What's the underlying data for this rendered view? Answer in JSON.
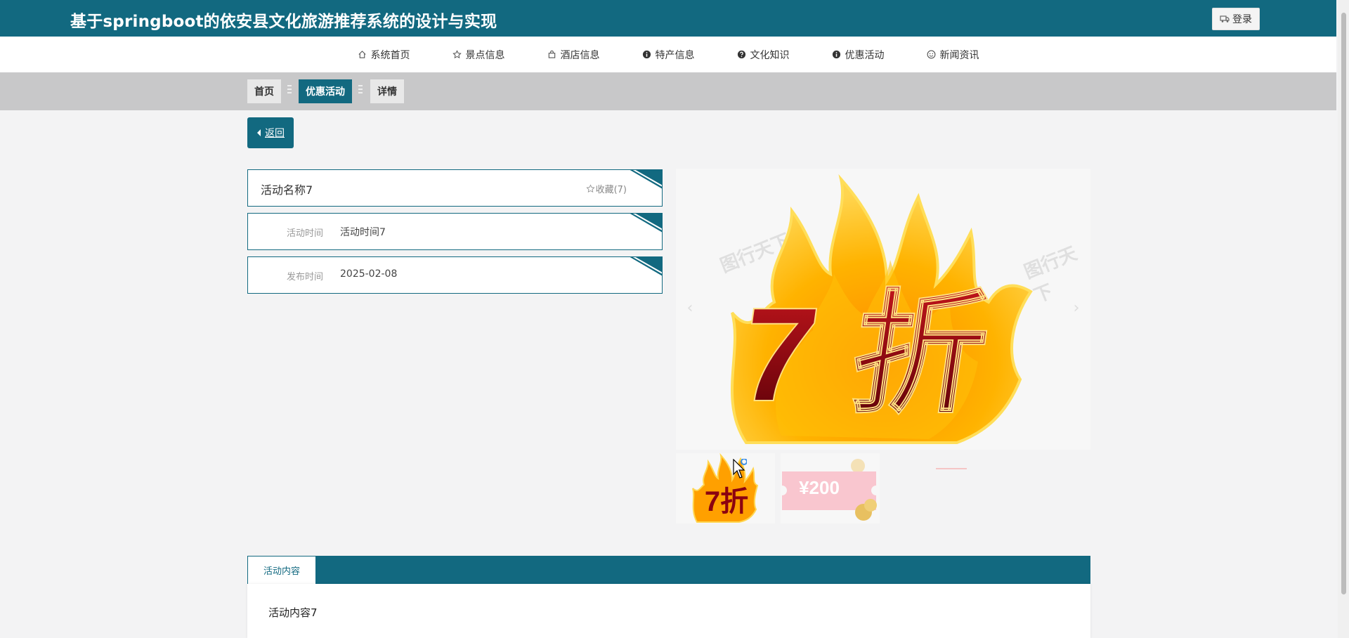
{
  "header": {
    "title": "基于springboot的依安县文化旅游推荐系统的设计与实现",
    "login_label": "登录",
    "accent": "#126980"
  },
  "nav": {
    "items": [
      {
        "label": "系统首页",
        "icon": "home-icon"
      },
      {
        "label": "景点信息",
        "icon": "star-icon"
      },
      {
        "label": "酒店信息",
        "icon": "bag-icon"
      },
      {
        "label": "特产信息",
        "icon": "info-icon"
      },
      {
        "label": "文化知识",
        "icon": "question-icon"
      },
      {
        "label": "优惠活动",
        "icon": "info-icon"
      },
      {
        "label": "新闻资讯",
        "icon": "smile-icon"
      }
    ]
  },
  "breadcrumb": {
    "items": [
      "首页",
      "优惠活动",
      "详情"
    ]
  },
  "back_label": "返回",
  "detail": {
    "name": "活动名称7",
    "favorite_label": "收藏(7)",
    "fields": [
      {
        "label": "活动时间",
        "value": "活动时间7"
      },
      {
        "label": "发布时间",
        "value": "2025-02-08"
      }
    ]
  },
  "gallery": {
    "main_text": "7 折",
    "watermark": "图行天下",
    "thumb1_text": "7折",
    "thumb2_amount": "¥200"
  },
  "tabs": {
    "active_label": "活动内容"
  },
  "content": {
    "text": "活动内容7"
  }
}
